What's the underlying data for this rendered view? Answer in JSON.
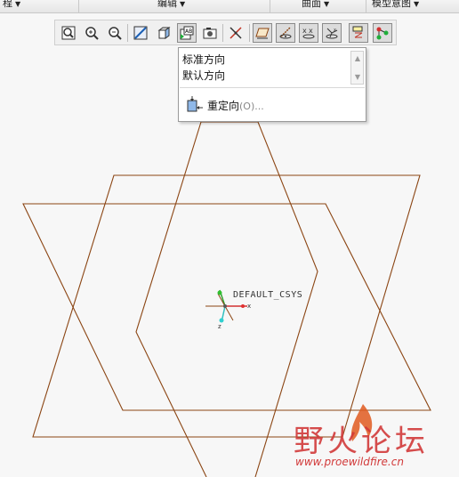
{
  "menubar": {
    "items": [
      {
        "label": "程",
        "has_arrow": true
      },
      {
        "label": "编辑",
        "has_arrow": true
      },
      {
        "label": "曲面",
        "has_arrow": true
      },
      {
        "label": "模型意图",
        "has_arrow": true
      }
    ]
  },
  "toolbar": {
    "buttons": [
      {
        "name": "refit-icon"
      },
      {
        "name": "zoom-in-icon"
      },
      {
        "name": "zoom-out-icon"
      },
      {
        "name": "display-style-icon"
      },
      {
        "name": "view-orientation-icon"
      },
      {
        "name": "saved-views-icon"
      },
      {
        "name": "view-manager-icon"
      },
      {
        "name": "spin-center-icon"
      },
      {
        "name": "datum-plane-display-icon"
      },
      {
        "name": "datum-axis-display-icon"
      },
      {
        "name": "point-display-icon"
      },
      {
        "name": "csys-display-icon"
      },
      {
        "name": "annotation-display-icon"
      },
      {
        "name": "appearance-icon"
      }
    ]
  },
  "dropdown": {
    "items": [
      "标准方向",
      "默认方向"
    ],
    "reorient_label": "重定向",
    "reorient_hint": "(O)..."
  },
  "canvas": {
    "csys_label": "DEFAULT_CSYS",
    "axis_x": "x",
    "axis_z": "z",
    "datum_color": "#8b4513"
  },
  "watermark": {
    "text": "野火论坛",
    "url": "www.proewildfire.cn"
  }
}
